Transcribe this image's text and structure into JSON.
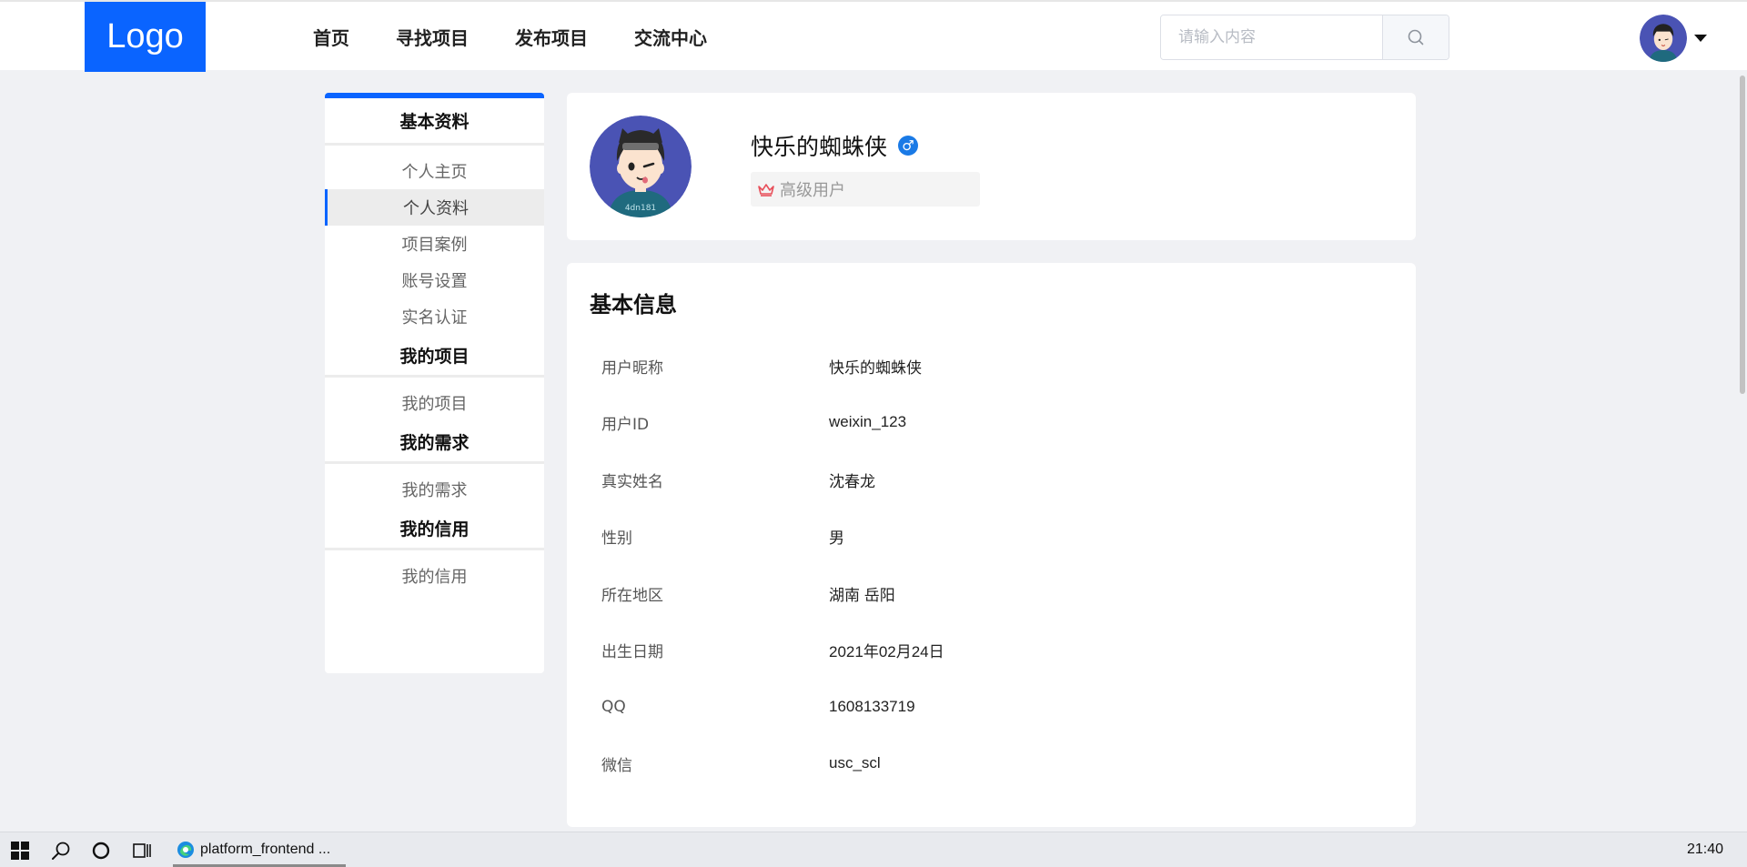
{
  "header": {
    "logo": "Logo",
    "nav": [
      "首页",
      "寻找项目",
      "发布项目",
      "交流中心"
    ],
    "search_placeholder": "请输入内容"
  },
  "sidebar": {
    "sections": [
      {
        "title": "基本资料",
        "items": [
          "个人主页",
          "个人资料",
          "项目案例",
          "账号设置",
          "实名认证"
        ],
        "active": 1
      },
      {
        "title": "我的项目",
        "items": [
          "我的项目"
        ]
      },
      {
        "title": "我的需求",
        "items": [
          "我的需求"
        ]
      },
      {
        "title": "我的信用",
        "items": [
          "我的信用"
        ]
      }
    ]
  },
  "profile": {
    "name": "快乐的蜘蛛侠",
    "gender_symbol": "♂",
    "level": "高级用户"
  },
  "info": {
    "title": "基本信息",
    "rows": [
      {
        "label": "用户昵称",
        "value": "快乐的蜘蛛侠"
      },
      {
        "label": "用户ID",
        "value": "weixin_123"
      },
      {
        "label": "真实姓名",
        "value": "沈春龙"
      },
      {
        "label": "性别",
        "value": "男"
      },
      {
        "label": "所在地区",
        "value": "湖南 岳阳"
      },
      {
        "label": "出生日期",
        "value": "2021年02月24日"
      },
      {
        "label": "QQ",
        "value": "1608133719"
      },
      {
        "label": "微信",
        "value": "usc_scl"
      }
    ]
  },
  "taskbar": {
    "app_label": "platform_frontend ...",
    "clock": "21:40"
  },
  "colors": {
    "accent": "#0a64ff",
    "background": "#f0f1f4",
    "gender_blue": "#1a7ae6"
  }
}
